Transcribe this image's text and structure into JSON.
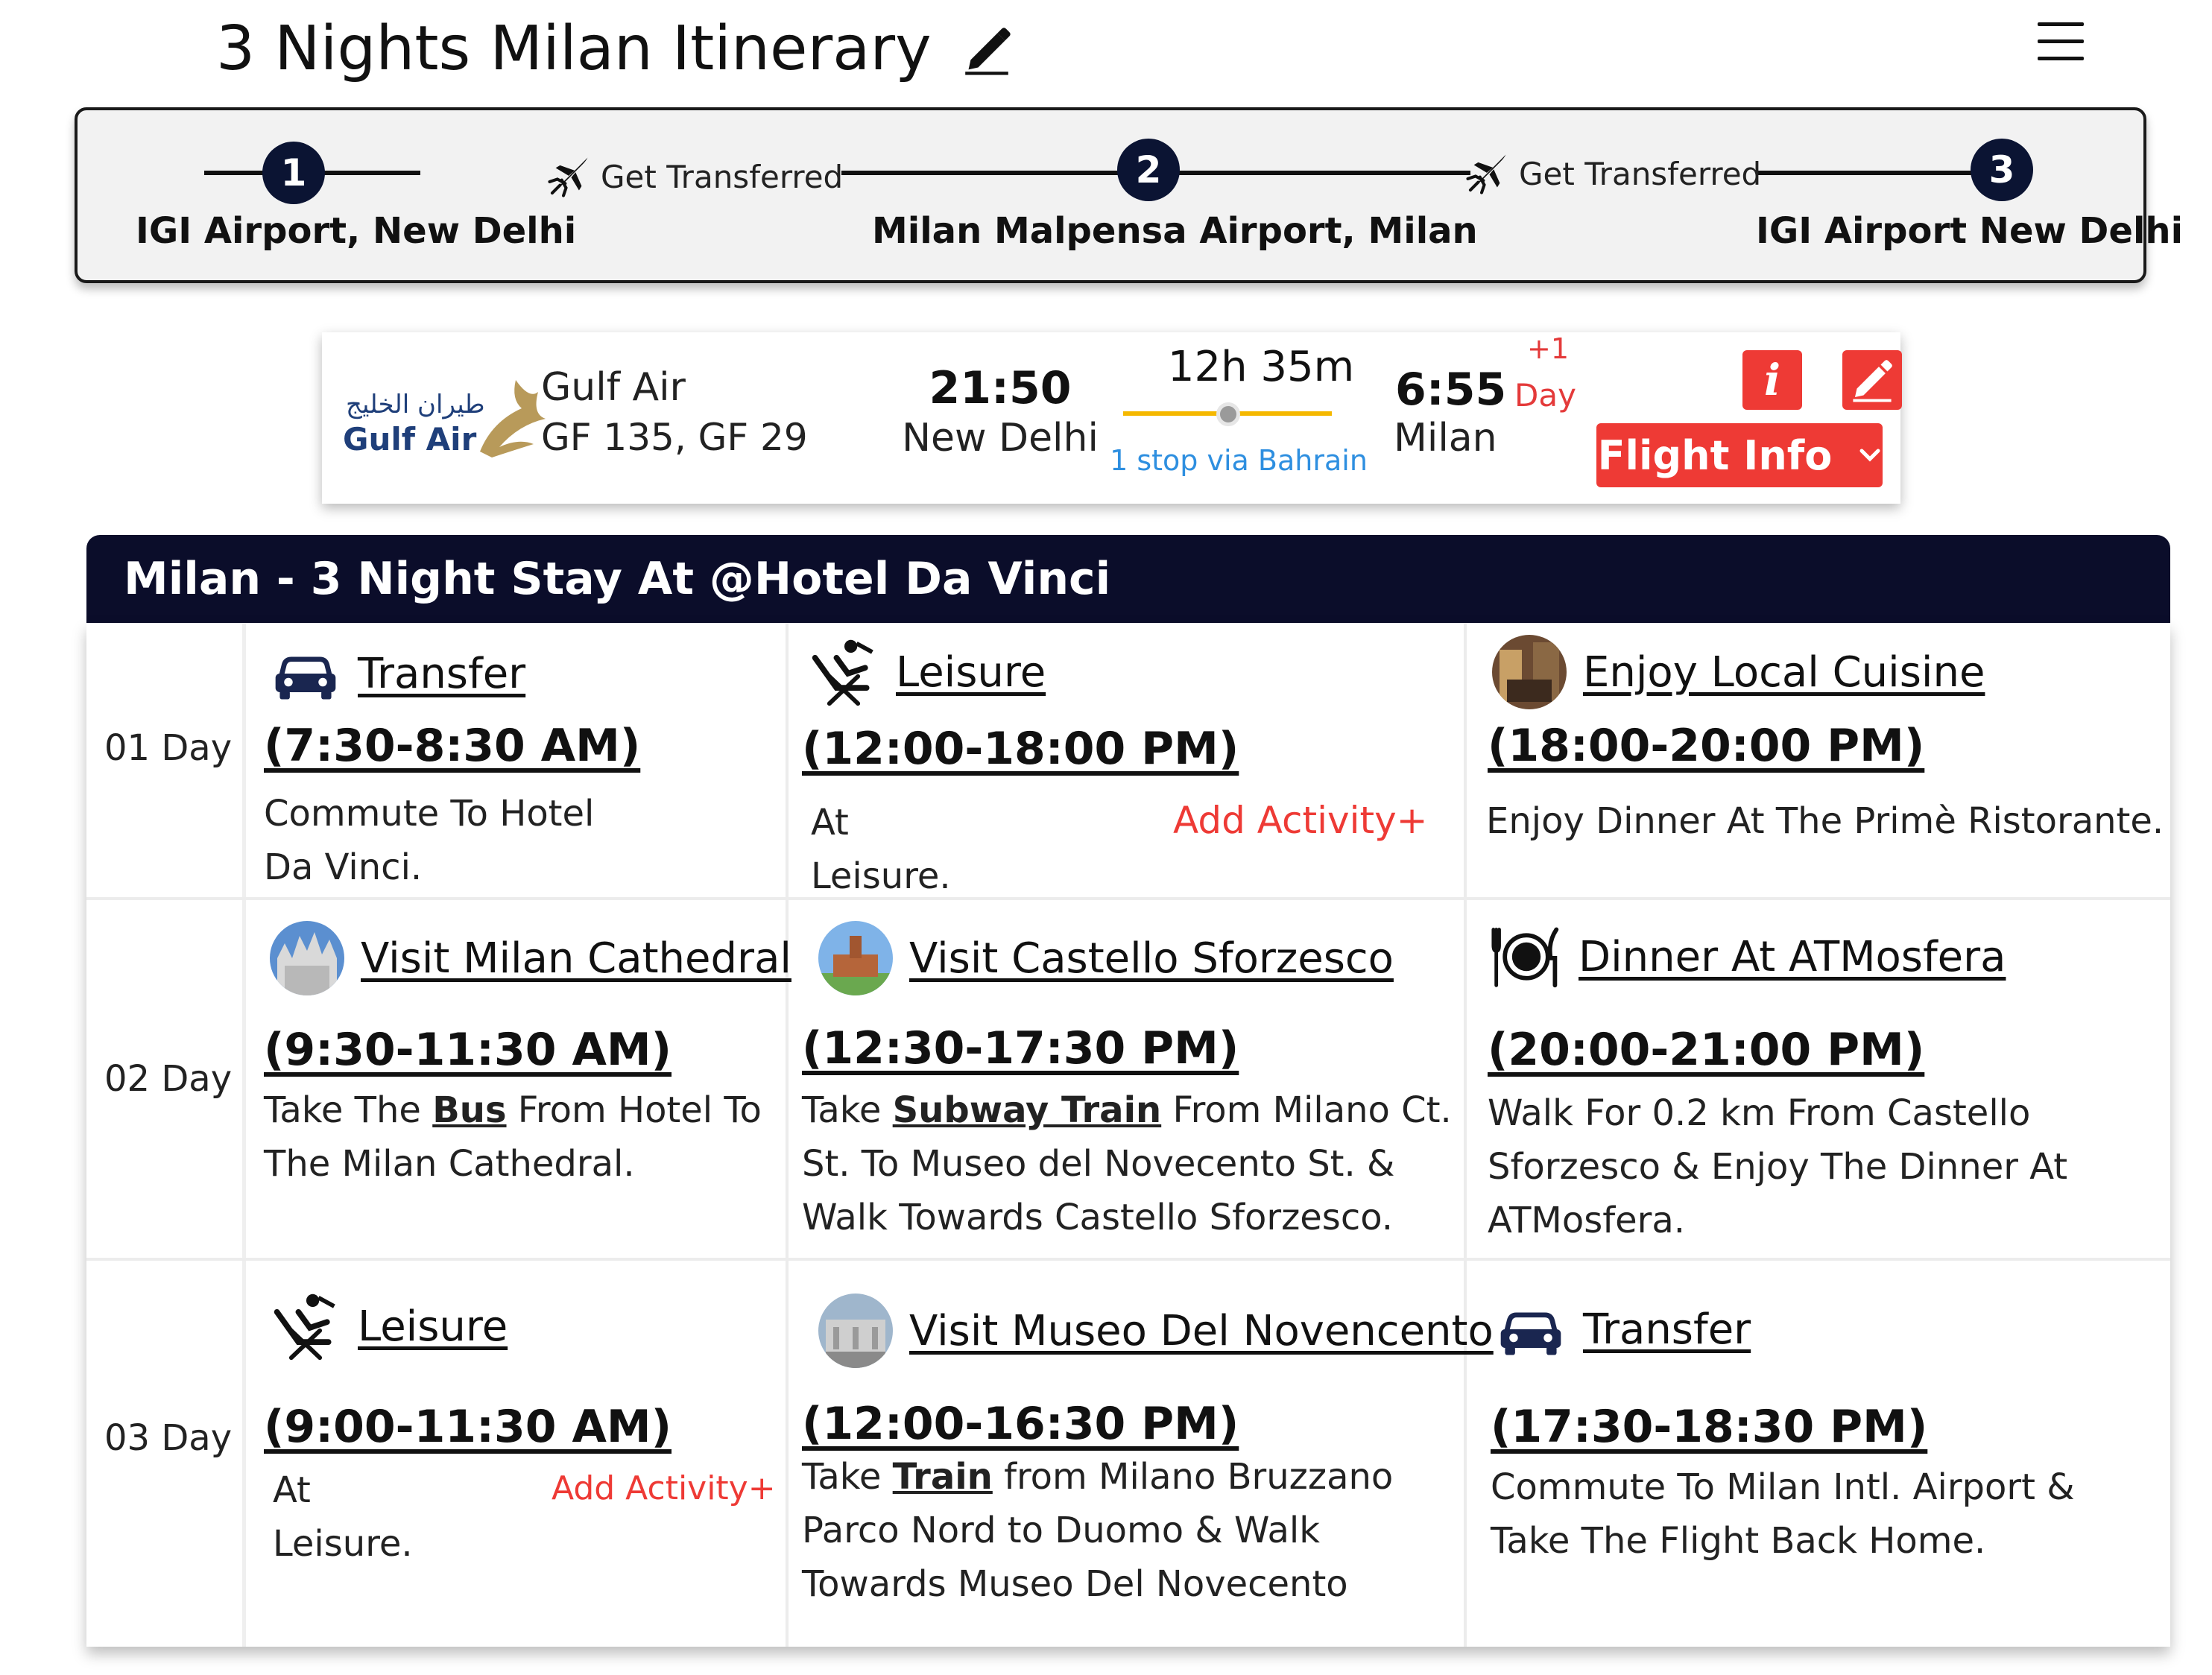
{
  "header": {
    "title": "3 Nights Milan Itinerary"
  },
  "route": {
    "steps": [
      {
        "num": "1",
        "name": "IGI Airport, New Delhi"
      },
      {
        "num": "2",
        "name": "Milan Malpensa Airport, Milan"
      },
      {
        "num": "3",
        "name": "IGI Airport New Delhi"
      }
    ],
    "transfer_label": "Get Transferred"
  },
  "flight": {
    "logo_english": "Gulf Air",
    "logo_arabic": "طيران الخليج",
    "airline": "Gulf Air",
    "flight_numbers": "GF 135, GF 29",
    "departure_time": "21:50",
    "departure_city": "New Delhi",
    "duration": "12h 35m",
    "stops": "1 stop via Bahrain",
    "arrival_time": "6:55",
    "arrival_city": "Milan",
    "day_offset": "+1",
    "day_offset_label": "Day",
    "info_icon": "i",
    "flight_info_label": "Flight Info"
  },
  "stay": {
    "title": "Milan - 3 Night Stay At @Hotel Da Vinci"
  },
  "days": [
    {
      "label": "01 Day"
    },
    {
      "label": "02 Day"
    },
    {
      "label": "03 Day"
    }
  ],
  "activities": {
    "d1a": {
      "icon": "car-icon",
      "title": "Transfer",
      "time": "(7:30-8:30 AM)",
      "desc_line1": "Commute To Hotel",
      "desc_line2": "Da Vinci."
    },
    "d1b": {
      "icon": "leisure-icon",
      "title": "Leisure",
      "time": "(12:00-18:00 PM)",
      "desc": "At Leisure.",
      "add": "Add Activity+"
    },
    "d1c": {
      "icon": "restaurant-photo",
      "title": "Enjoy Local Cuisine",
      "time": "(18:00-20:00 PM)",
      "desc": "Enjoy Dinner At The Primè Ristorante."
    },
    "d2a": {
      "icon": "cathedral-photo",
      "title": "Visit Milan Cathedral",
      "time": "(9:30-11:30 AM)",
      "desc_pre": "Take The ",
      "desc_bold": "Bus",
      "desc_post": " From Hotel To",
      "desc_line2": "The Milan Cathedral."
    },
    "d2b": {
      "icon": "castle-photo",
      "title": "Visit Castello Sforzesco",
      "time": "(12:30-17:30 PM)",
      "desc_pre": "Take ",
      "desc_bold": "Subway Train",
      "desc_post": " From Milano Ct.",
      "desc_line2": "St. To Museo del Novecento St. &",
      "desc_line3": "Walk Towards Castello Sforzesco."
    },
    "d2c": {
      "icon": "dinner-plate-icon",
      "title": "Dinner At ATMosfera",
      "time": "(20:00-21:00 PM)",
      "desc_line1": "Walk For 0.2 km From Castello",
      "desc_line2": "Sforzesco & Enjoy The Dinner At",
      "desc_line3": "ATMosfera."
    },
    "d3a": {
      "icon": "leisure-icon",
      "title": "Leisure",
      "time": "(9:00-11:30 AM)",
      "desc": "At Leisure.",
      "add": "Add Activity+"
    },
    "d3b": {
      "icon": "museum-photo",
      "title": "Visit Museo Del Novencento",
      "time": "(12:00-16:30 PM)",
      "desc_pre": "Take ",
      "desc_bold": "Train",
      "desc_post": " from Milano Bruzzano",
      "desc_line2": "Parco Nord to Duomo & Walk",
      "desc_line3": "Towards Museo Del Novecento"
    },
    "d3c": {
      "icon": "car-icon",
      "title": "Transfer",
      "time": "(17:30-18:30 PM)",
      "desc_line1": "Commute To Milan Intl. Airport &",
      "desc_line2": "Take The Flight Back Home."
    }
  },
  "colors": {
    "navy": "#0b1433",
    "accent_red": "#ee3a35",
    "stop_blue": "#2e8fe0",
    "duration_bar": "#f5b800"
  }
}
